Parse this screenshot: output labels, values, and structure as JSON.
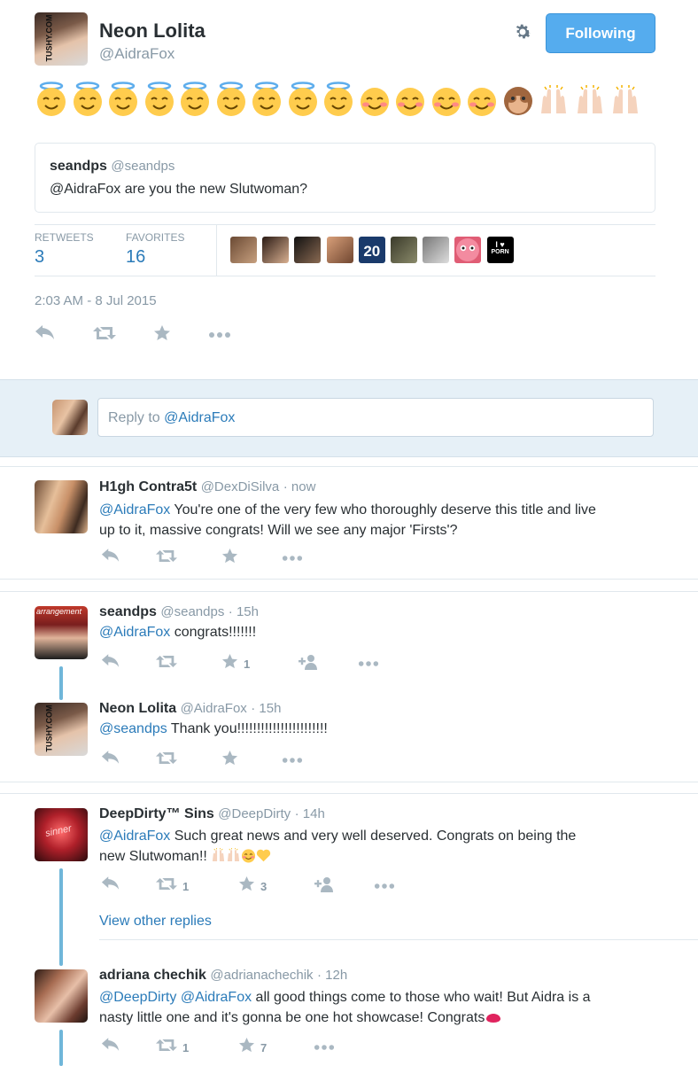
{
  "tweet": {
    "author_name": "Neon Lolita",
    "author_handle": "@AidraFox",
    "avatar_watermark": "TUSHY.COM",
    "follow_label": "Following",
    "emoji_sequence": {
      "halo": 9,
      "blush": 4,
      "monkey": 1,
      "raised_hands": 3
    },
    "quoted": {
      "name": "seandps",
      "handle": "@seandps",
      "text": "@AidraFox are you the new Slutwoman?"
    },
    "stats": {
      "retweets_label": "RETWEETS",
      "retweets_value": "3",
      "favorites_label": "FAVORITES",
      "favorites_value": "16"
    },
    "timestamp": "2:03 AM - 8 Jul 2015"
  },
  "reply_box": {
    "placeholder_prefix": "Reply to ",
    "placeholder_mention": "@AidraFox"
  },
  "replies": [
    {
      "name": "H1gh Contra5t",
      "handle": "@DexDiSilva",
      "time": "· now",
      "mention": "@AidraFox",
      "text_line1": " You're one of the very few who thoroughly deserve this title and live",
      "text_line2": "up to it, massive congrats! Will we see any major 'Firsts'?"
    },
    {
      "name": "seandps",
      "handle": "@seandps",
      "time": "· 15h",
      "mention": "@AidraFox",
      "text": " congrats!!!!!!!",
      "favorites": "1",
      "avatar_text": "arrangement"
    },
    {
      "name": "Neon Lolita",
      "handle": "@AidraFox",
      "time": "· 15h",
      "mention": "@seandps",
      "text": " Thank you!!!!!!!!!!!!!!!!!!!!!!!",
      "avatar_watermark": "TUSHY.COM"
    },
    {
      "name": "DeepDirty™ Sins",
      "handle": "@DeepDirty",
      "time": "· 14h",
      "mention": "@AidraFox",
      "text_line1": " Such great news and very well deserved. Congrats on being the",
      "text_line2": "new Slutwoman!! ",
      "retweets": "1",
      "favorites": "3",
      "view_other": "View other replies",
      "avatar_text": "sinner"
    },
    {
      "name": "adriana chechik",
      "handle": "@adrianachechik",
      "time": "· 12h",
      "mention1": "@DeepDirty",
      "mention2": "@AidraFox",
      "text_line1": " all good things come to those who wait! But Aidra is a",
      "text_line2": "nasty little one and it's gonna be one hot showcase! Congrats",
      "retweets": "1",
      "favorites": "7"
    }
  ],
  "favoriter_avatars": {
    "jersey_number": "20",
    "love_badge_line1": "I ♥",
    "love_badge_line2": "PORN"
  },
  "colors": {
    "accent": "#55acee",
    "link": "#2b7bb9",
    "muted": "#8899a6",
    "thread": "#6fb6d9",
    "reply_bg": "#e6f0f7"
  },
  "icons": [
    "gear-icon",
    "reply-icon",
    "retweet-icon",
    "favorite-icon",
    "more-icon",
    "follow-icon"
  ]
}
